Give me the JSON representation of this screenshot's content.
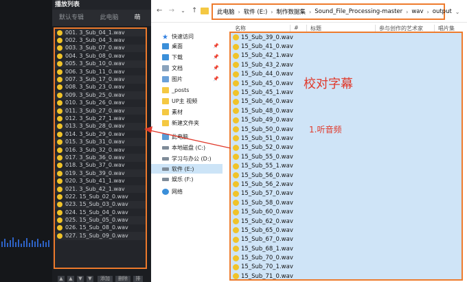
{
  "player": {
    "header": "播放列表",
    "tabs": [
      "默认专辑",
      "此电脑",
      "萌"
    ],
    "tracks": [
      "001. 3_Sub_04_1.wav",
      "002. 3_Sub_04_3.wav",
      "003. 3_Sub_07_0.wav",
      "004. 3_Sub_08_0.wav",
      "005. 3_Sub_10_0.wav",
      "006. 3_Sub_11_0.wav",
      "007. 3_Sub_17_0.wav",
      "008. 3_Sub_23_0.wav",
      "009. 3_Sub_25_0.wav",
      "010. 3_Sub_26_0.wav",
      "011. 3_Sub_27_0.wav",
      "012. 3_Sub_27_1.wav",
      "013. 3_Sub_28_0.wav",
      "014. 3_Sub_29_0.wav",
      "015. 3_Sub_31_0.wav",
      "016. 3_Sub_32_0.wav",
      "017. 3_Sub_36_0.wav",
      "018. 3_Sub_37_0.wav",
      "019. 3_Sub_39_0.wav",
      "020. 3_Sub_41_1.wav",
      "021. 3_Sub_42_1.wav",
      "022. 15_Sub_02_0.wav",
      "023. 15_Sub_03_0.wav",
      "024. 15_Sub_04_0.wav",
      "025. 15_Sub_05_0.wav",
      "026. 15_Sub_08_0.wav",
      "027. 15_Sub_09_0.wav"
    ],
    "controls": [
      "▲",
      "▲",
      "▼",
      "▼",
      "添加",
      "删除",
      "排"
    ]
  },
  "explorer": {
    "breadcrumb": [
      "此电脑",
      "软件 (E:)",
      "制作数据集",
      "Sound_File_Processing-master",
      "wav",
      "output"
    ],
    "nav_items": [
      {
        "label": "快速访问",
        "icon": "star-icon"
      },
      {
        "label": "桌面",
        "icon": "desktop-icon"
      },
      {
        "label": "下载",
        "icon": "download-icon"
      },
      {
        "label": "文档",
        "icon": "document-icon"
      },
      {
        "label": "图片",
        "icon": "picture-icon"
      },
      {
        "label": "_posts",
        "icon": "folder-icon"
      },
      {
        "label": "UP主 视频",
        "icon": "folder-icon"
      },
      {
        "label": "素材",
        "icon": "folder-icon"
      },
      {
        "label": "新建文件夹",
        "icon": "folder-icon"
      },
      {
        "label": "此电脑",
        "icon": "computer-icon"
      },
      {
        "label": "本地磁盘 (C:)",
        "icon": "drive-icon"
      },
      {
        "label": "学习与办公 (D:)",
        "icon": "drive-icon"
      },
      {
        "label": "软件 (E:)",
        "icon": "drive-icon"
      },
      {
        "label": "娱乐 (F:)",
        "icon": "drive-icon"
      },
      {
        "label": "网络",
        "icon": "network-icon"
      }
    ],
    "columns": [
      "名称",
      "#",
      "标题",
      "参与创作的艺术家",
      "唱片集"
    ],
    "files": [
      "15_Sub_39_0.wav",
      "15_Sub_41_0.wav",
      "15_Sub_42_1.wav",
      "15_Sub_43_2.wav",
      "15_Sub_44_0.wav",
      "15_Sub_45_0.wav",
      "15_Sub_45_1.wav",
      "15_Sub_46_0.wav",
      "15_Sub_48_0.wav",
      "15_Sub_49_0.wav",
      "15_Sub_50_0.wav",
      "15_Sub_51_0.wav",
      "15_Sub_52_0.wav",
      "15_Sub_55_0.wav",
      "15_Sub_55_1.wav",
      "15_Sub_56_0.wav",
      "15_Sub_56_2.wav",
      "15_Sub_57_0.wav",
      "15_Sub_58_0.wav",
      "15_Sub_60_0.wav",
      "15_Sub_62_0.wav",
      "15_Sub_65_0.wav",
      "15_Sub_67_0.wav",
      "15_Sub_68_1.wav",
      "15_Sub_70_0.wav",
      "15_Sub_70_1.wav",
      "15_Sub_71_0.wav"
    ],
    "annotation_main": "校对字幕",
    "annotation_step": "1.听音频"
  },
  "colors": {
    "highlight": "#ee7a2b",
    "annotation": "#e0392b",
    "selection": "#cfe4f7",
    "track_icon": "#f0c329"
  }
}
